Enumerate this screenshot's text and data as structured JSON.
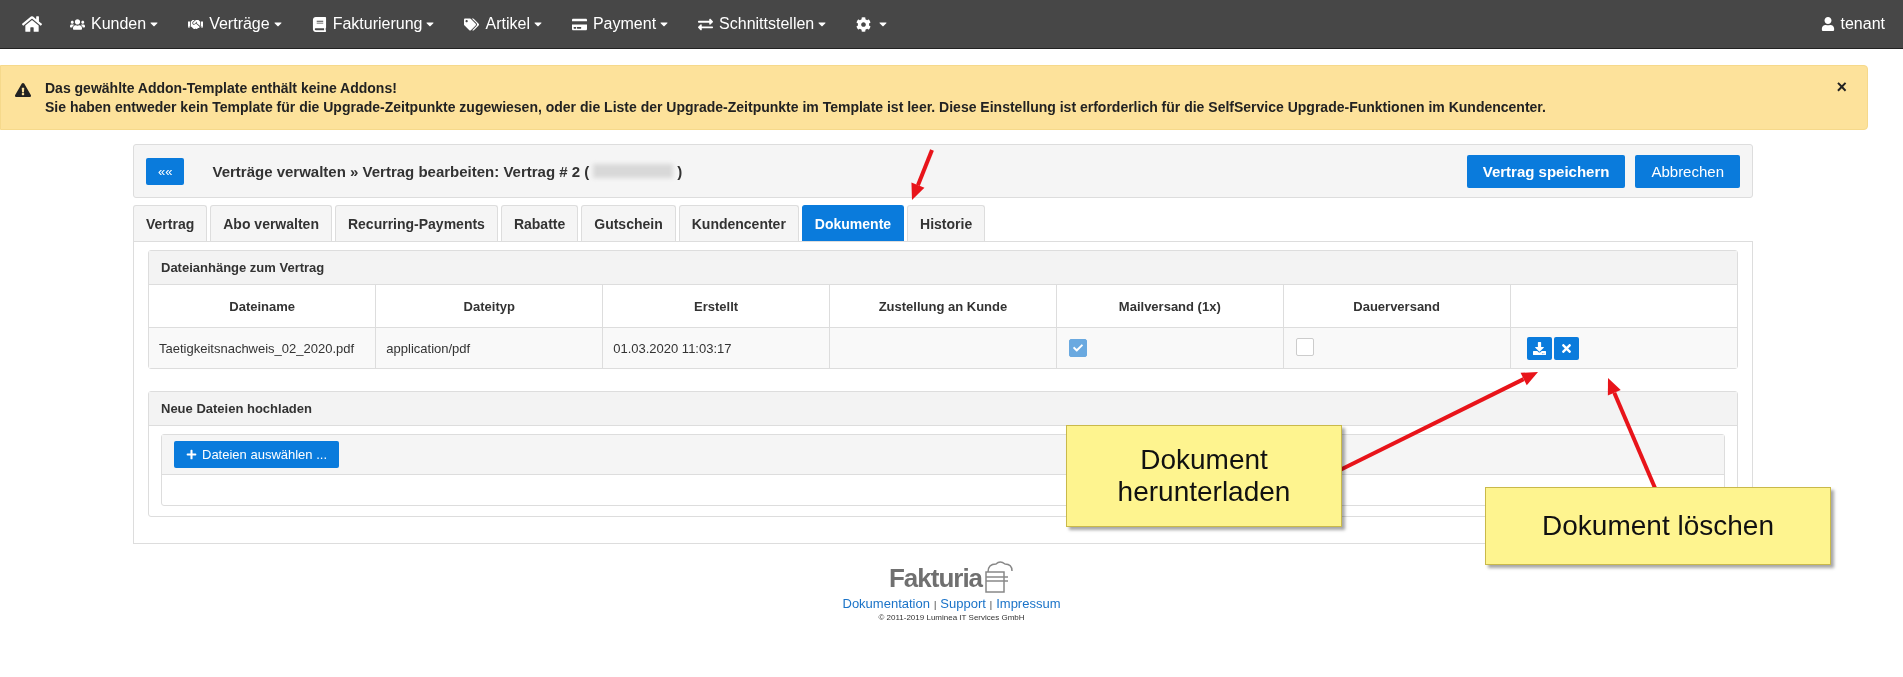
{
  "navbar": {
    "items": [
      {
        "label": "Kunden"
      },
      {
        "label": "Verträge"
      },
      {
        "label": "Fakturierung"
      },
      {
        "label": "Artikel"
      },
      {
        "label": "Payment"
      },
      {
        "label": "Schnittstellen"
      }
    ],
    "user": "tenant"
  },
  "alert": {
    "title": "Das gewählte Addon-Template enthält keine Addons!",
    "message": "Sie haben entweder kein Template für die Upgrade-Zeitpunkte zugewiesen, oder die Liste der Upgrade-Zeitpunkte im Template ist leer. Diese Einstellung ist erforderlich für die SelfService Upgrade-Funktionen im Kundencenter.",
    "close": "×"
  },
  "header": {
    "back": "««",
    "title": "Verträge verwalten » Vertrag bearbeiten: Vertrag # 2 (",
    "title_end": ")",
    "buttons": [
      {
        "label": "Vertrag speichern"
      },
      {
        "label": "Abbrechen"
      }
    ]
  },
  "tabs": [
    {
      "label": "Vertrag",
      "selected": false
    },
    {
      "label": "Abo verwalten",
      "selected": false
    },
    {
      "label": "Recurring-Payments",
      "selected": false
    },
    {
      "label": "Rabatte",
      "selected": false
    },
    {
      "label": "Gutschein",
      "selected": false
    },
    {
      "label": "Kundencenter",
      "selected": false
    },
    {
      "label": "Dokumente",
      "selected": true
    },
    {
      "label": "Historie",
      "selected": false
    }
  ],
  "attachments": {
    "title": "Dateianhänge zum Vertrag",
    "columns": [
      "Dateiname",
      "Dateityp",
      "Erstellt",
      "Zustellung an Kunde",
      "Mailversand (1x)",
      "Dauerversand"
    ],
    "rows": [
      {
        "filename": "Taetigkeitsnachweis_02_2020.pdf",
        "type": "application/pdf",
        "created": "01.03.2020 11:03:17",
        "mail_once": {
          "checked": true
        },
        "permanent": {
          "checked": false
        }
      }
    ]
  },
  "upload": {
    "title": "Neue Dateien hochladen",
    "button": "Dateien auswählen ..."
  },
  "footer": {
    "logo": "Fakturia",
    "links": [
      "Dokumentation",
      "Support",
      "Impressum"
    ],
    "separator": "|",
    "copyright": "© 2011-2019 Luminea IT Services GmbH"
  },
  "annotations": [
    {
      "text": "Dokument herunterladen",
      "kind": "callout"
    },
    {
      "text": "Dokument löschen",
      "kind": "callout"
    }
  ]
}
